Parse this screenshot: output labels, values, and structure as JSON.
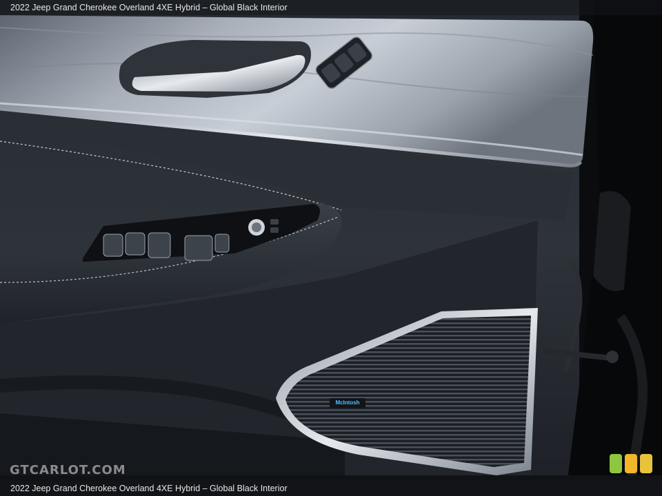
{
  "caption": {
    "top": "2022 Jeep Grand Cherokee Overland 4XE Hybrid – Global Black Interior",
    "bottom": "2022 Jeep Grand Cherokee Overland 4XE Hybrid – Global Black Interior"
  },
  "watermark": "GTCARLOT.COM",
  "speaker_badge": "McIntosh",
  "swatch_colors": [
    "#8dc63f",
    "#f0b62c",
    "#e8c23a"
  ]
}
